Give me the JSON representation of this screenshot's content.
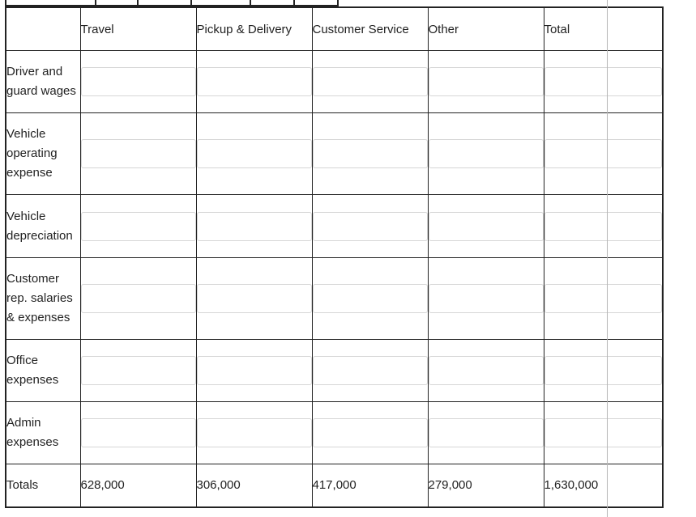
{
  "table": {
    "columns": [
      "",
      "Travel",
      "Pickup & Delivery",
      "Customer Service",
      "Other",
      "Total"
    ],
    "rows": [
      {
        "label": "Driver and guard wages",
        "values": [
          "",
          "",
          "",
          "",
          ""
        ]
      },
      {
        "label": "Vehicle operating expense",
        "values": [
          "",
          "",
          "",
          "",
          ""
        ]
      },
      {
        "label": "Vehicle depreciation",
        "values": [
          "",
          "",
          "",
          "",
          ""
        ]
      },
      {
        "label": "Customer rep. salaries & expenses",
        "values": [
          "",
          "",
          "",
          "",
          ""
        ]
      },
      {
        "label": "Office expenses",
        "values": [
          "",
          "",
          "",
          "",
          ""
        ]
      },
      {
        "label": "Admin expenses",
        "values": [
          "",
          "",
          "",
          "",
          ""
        ]
      }
    ],
    "totals": {
      "label": "Totals",
      "values": [
        "628,000",
        "306,000",
        "417,000",
        "279,000",
        "1,630,000"
      ]
    }
  }
}
